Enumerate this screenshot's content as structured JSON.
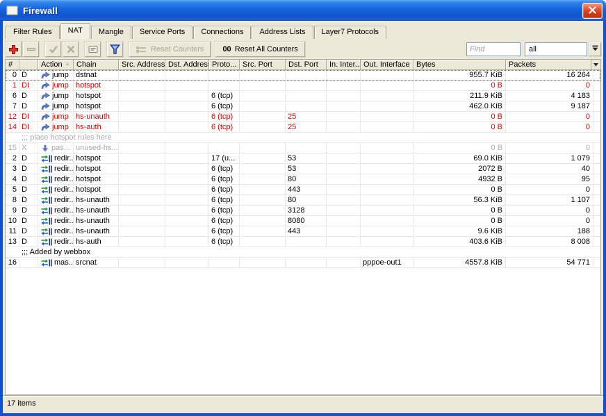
{
  "window": {
    "title": "Firewall",
    "status_text": "17 items"
  },
  "tabs": [
    {
      "label": "Filter Rules",
      "active": false
    },
    {
      "label": "NAT",
      "active": true
    },
    {
      "label": "Mangle",
      "active": false
    },
    {
      "label": "Service Ports",
      "active": false
    },
    {
      "label": "Connections",
      "active": false
    },
    {
      "label": "Address Lists",
      "active": false
    },
    {
      "label": "Layer7 Protocols",
      "active": false
    }
  ],
  "toolbar": {
    "buttons": [
      {
        "icon": "add-icon",
        "enabled": true
      },
      {
        "icon": "remove-icon",
        "enabled": false
      },
      {
        "icon": "enable-icon",
        "enabled": false
      },
      {
        "icon": "disable-icon",
        "enabled": false
      },
      {
        "icon": "comment-icon",
        "enabled": true
      },
      {
        "icon": "filter-icon",
        "enabled": true
      }
    ],
    "reset_counters_label": "Reset Counters",
    "reset_all_prefix": "00",
    "reset_all_label": "Reset All Counters",
    "find_placeholder": "Find",
    "filter_value": "all"
  },
  "table": {
    "headers": [
      {
        "label": "#",
        "sorted": false
      },
      {
        "label": "",
        "sorted": false
      },
      {
        "label": "Action",
        "sorted": true
      },
      {
        "label": "Chain",
        "sorted": false
      },
      {
        "label": "Src. Address",
        "sorted": false
      },
      {
        "label": "Dst. Address",
        "sorted": false
      },
      {
        "label": "Proto...",
        "sorted": false
      },
      {
        "label": "Src. Port",
        "sorted": false
      },
      {
        "label": "Dst. Port",
        "sorted": false
      },
      {
        "label": "In. Inter...",
        "sorted": false
      },
      {
        "label": "Out. Interface",
        "sorted": true
      },
      {
        "label": "Bytes",
        "sorted": false
      },
      {
        "label": "Packets",
        "sorted": false
      }
    ]
  },
  "rows": [
    {
      "type": "rule",
      "num": "0",
      "flags": "D",
      "icon": "jump-icon",
      "action": "jump",
      "chain": "dstnat",
      "src_address": "",
      "dst_address": "",
      "protocol": "",
      "src_port": "",
      "dst_port": "",
      "in_interface": "",
      "out_interface": "",
      "bytes": "955.7 KiB",
      "packets": "16 264",
      "state": "normal",
      "focused": true
    },
    {
      "type": "rule",
      "num": "1",
      "flags": "DI",
      "icon": "jump-icon",
      "action": "jump",
      "chain": "hotspot",
      "src_address": "",
      "dst_address": "",
      "protocol": "",
      "src_port": "",
      "dst_port": "",
      "in_interface": "",
      "out_interface": "",
      "bytes": "0 B",
      "packets": "0",
      "state": "invalid",
      "focused": false
    },
    {
      "type": "rule",
      "num": "6",
      "flags": "D",
      "icon": "jump-icon",
      "action": "jump",
      "chain": "hotspot",
      "src_address": "",
      "dst_address": "",
      "protocol": "6 (tcp)",
      "src_port": "",
      "dst_port": "",
      "in_interface": "",
      "out_interface": "",
      "bytes": "211.9 KiB",
      "packets": "4 183",
      "state": "normal",
      "focused": false
    },
    {
      "type": "rule",
      "num": "7",
      "flags": "D",
      "icon": "jump-icon",
      "action": "jump",
      "chain": "hotspot",
      "src_address": "",
      "dst_address": "",
      "protocol": "6 (tcp)",
      "src_port": "",
      "dst_port": "",
      "in_interface": "",
      "out_interface": "",
      "bytes": "462.0 KiB",
      "packets": "9 187",
      "state": "normal",
      "focused": false
    },
    {
      "type": "rule",
      "num": "12",
      "flags": "DI",
      "icon": "jump-icon",
      "action": "jump",
      "chain": "hs-unauth",
      "src_address": "",
      "dst_address": "",
      "protocol": "6 (tcp)",
      "src_port": "",
      "dst_port": "25",
      "in_interface": "",
      "out_interface": "",
      "bytes": "0 B",
      "packets": "0",
      "state": "invalid",
      "focused": false
    },
    {
      "type": "rule",
      "num": "14",
      "flags": "DI",
      "icon": "jump-icon",
      "action": "jump",
      "chain": "hs-auth",
      "src_address": "",
      "dst_address": "",
      "protocol": "6 (tcp)",
      "src_port": "",
      "dst_port": "25",
      "in_interface": "",
      "out_interface": "",
      "bytes": "0 B",
      "packets": "0",
      "state": "invalid",
      "focused": false
    },
    {
      "type": "comment",
      "text": ";;; place hotspot rules here",
      "muted": true
    },
    {
      "type": "rule",
      "num": "15",
      "flags": "X",
      "icon": "passthrough-icon",
      "action": "pas...",
      "chain": "unused-hs...",
      "src_address": "",
      "dst_address": "",
      "protocol": "",
      "src_port": "",
      "dst_port": "",
      "in_interface": "",
      "out_interface": "",
      "bytes": "0 B",
      "packets": "0",
      "state": "disabled",
      "focused": false
    },
    {
      "type": "rule",
      "num": "2",
      "flags": "D",
      "icon": "redirect-icon",
      "action": "redir...",
      "chain": "hotspot",
      "src_address": "",
      "dst_address": "",
      "protocol": "17 (u...",
      "src_port": "",
      "dst_port": "53",
      "in_interface": "",
      "out_interface": "",
      "bytes": "69.0 KiB",
      "packets": "1 079",
      "state": "normal",
      "focused": false
    },
    {
      "type": "rule",
      "num": "3",
      "flags": "D",
      "icon": "redirect-icon",
      "action": "redir...",
      "chain": "hotspot",
      "src_address": "",
      "dst_address": "",
      "protocol": "6 (tcp)",
      "src_port": "",
      "dst_port": "53",
      "in_interface": "",
      "out_interface": "",
      "bytes": "2072 B",
      "packets": "40",
      "state": "normal",
      "focused": false
    },
    {
      "type": "rule",
      "num": "4",
      "flags": "D",
      "icon": "redirect-icon",
      "action": "redir...",
      "chain": "hotspot",
      "src_address": "",
      "dst_address": "",
      "protocol": "6 (tcp)",
      "src_port": "",
      "dst_port": "80",
      "in_interface": "",
      "out_interface": "",
      "bytes": "4932 B",
      "packets": "95",
      "state": "normal",
      "focused": false
    },
    {
      "type": "rule",
      "num": "5",
      "flags": "D",
      "icon": "redirect-icon",
      "action": "redir...",
      "chain": "hotspot",
      "src_address": "",
      "dst_address": "",
      "protocol": "6 (tcp)",
      "src_port": "",
      "dst_port": "443",
      "in_interface": "",
      "out_interface": "",
      "bytes": "0 B",
      "packets": "0",
      "state": "normal",
      "focused": false
    },
    {
      "type": "rule",
      "num": "8",
      "flags": "D",
      "icon": "redirect-icon",
      "action": "redir...",
      "chain": "hs-unauth",
      "src_address": "",
      "dst_address": "",
      "protocol": "6 (tcp)",
      "src_port": "",
      "dst_port": "80",
      "in_interface": "",
      "out_interface": "",
      "bytes": "56.3 KiB",
      "packets": "1 107",
      "state": "normal",
      "focused": false
    },
    {
      "type": "rule",
      "num": "9",
      "flags": "D",
      "icon": "redirect-icon",
      "action": "redir...",
      "chain": "hs-unauth",
      "src_address": "",
      "dst_address": "",
      "protocol": "6 (tcp)",
      "src_port": "",
      "dst_port": "3128",
      "in_interface": "",
      "out_interface": "",
      "bytes": "0 B",
      "packets": "0",
      "state": "normal",
      "focused": false
    },
    {
      "type": "rule",
      "num": "10",
      "flags": "D",
      "icon": "redirect-icon",
      "action": "redir...",
      "chain": "hs-unauth",
      "src_address": "",
      "dst_address": "",
      "protocol": "6 (tcp)",
      "src_port": "",
      "dst_port": "8080",
      "in_interface": "",
      "out_interface": "",
      "bytes": "0 B",
      "packets": "0",
      "state": "normal",
      "focused": false
    },
    {
      "type": "rule",
      "num": "11",
      "flags": "D",
      "icon": "redirect-icon",
      "action": "redir...",
      "chain": "hs-unauth",
      "src_address": "",
      "dst_address": "",
      "protocol": "6 (tcp)",
      "src_port": "",
      "dst_port": "443",
      "in_interface": "",
      "out_interface": "",
      "bytes": "9.6 KiB",
      "packets": "188",
      "state": "normal",
      "focused": false
    },
    {
      "type": "rule",
      "num": "13",
      "flags": "D",
      "icon": "redirect-icon",
      "action": "redir...",
      "chain": "hs-auth",
      "src_address": "",
      "dst_address": "",
      "protocol": "6 (tcp)",
      "src_port": "",
      "dst_port": "",
      "in_interface": "",
      "out_interface": "",
      "bytes": "403.6 KiB",
      "packets": "8 008",
      "state": "normal",
      "focused": false
    },
    {
      "type": "comment",
      "text": ";;; Added by webbox",
      "muted": false
    },
    {
      "type": "rule",
      "num": "16",
      "flags": "",
      "icon": "masquerade-icon",
      "action": "mas...",
      "chain": "srcnat",
      "src_address": "",
      "dst_address": "",
      "protocol": "",
      "src_port": "",
      "dst_port": "",
      "in_interface": "",
      "out_interface": "pppoe-out1",
      "bytes": "4557.8 KiB",
      "packets": "54 771",
      "state": "normal",
      "focused": false
    }
  ],
  "colors": {
    "invalid_text": "#E00000",
    "disabled_text": "#ABABAB",
    "titlebar_top": "#3287EC",
    "titlebar_bottom": "#1154CC",
    "window_border": "#0B52D4",
    "add_button_red": "#E03030",
    "filter_funnel_blue": "#1B3FA0"
  }
}
